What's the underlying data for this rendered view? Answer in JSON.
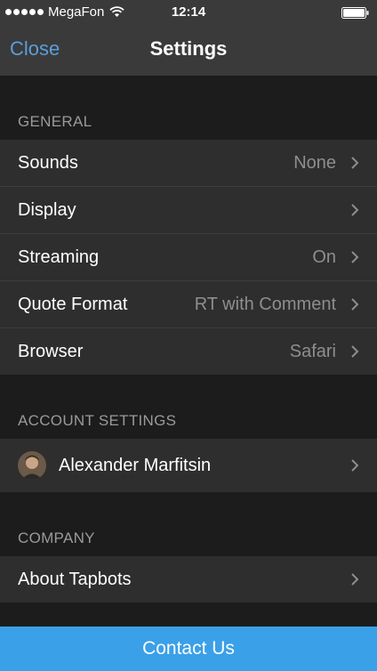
{
  "status_bar": {
    "carrier": "MegaFon",
    "time": "12:14"
  },
  "nav": {
    "close_label": "Close",
    "title": "Settings"
  },
  "sections": {
    "general": {
      "header": "GENERAL",
      "rows": [
        {
          "label": "Sounds",
          "value": "None"
        },
        {
          "label": "Display",
          "value": ""
        },
        {
          "label": "Streaming",
          "value": "On"
        },
        {
          "label": "Quote Format",
          "value": "RT with Comment"
        },
        {
          "label": "Browser",
          "value": "Safari"
        }
      ]
    },
    "account": {
      "header": "ACCOUNT SETTINGS",
      "user_name": "Alexander Marfitsin"
    },
    "company": {
      "header": "COMPANY",
      "rows": [
        {
          "label": "About Tapbots"
        }
      ]
    }
  },
  "footer": {
    "contact_label": "Contact Us"
  },
  "colors": {
    "accent": "#5a9edc",
    "contact_bar": "#3aa0e8",
    "row_bg": "#2e2e2e",
    "page_bg": "#1c1c1c"
  }
}
